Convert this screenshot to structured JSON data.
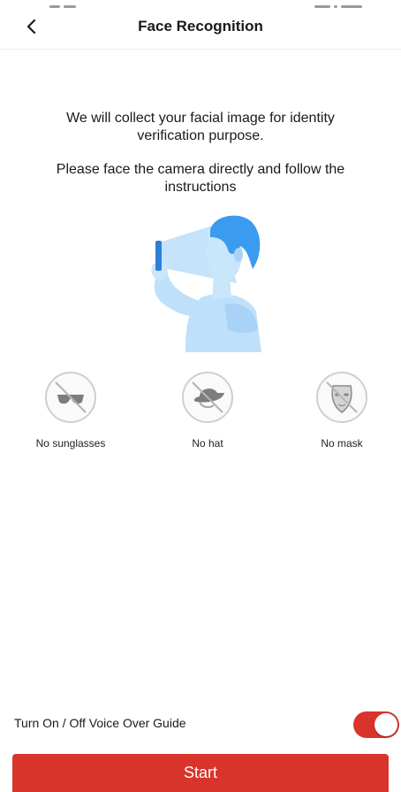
{
  "header": {
    "title": "Face Recognition"
  },
  "instructions": {
    "line1": "We will collect your facial image for identity verification purpose.",
    "line2": "Please face the camera directly and follow the instructions"
  },
  "requirements": [
    {
      "label": "No sunglasses",
      "icon": "no-sunglasses-icon"
    },
    {
      "label": "No hat",
      "icon": "no-hat-icon"
    },
    {
      "label": "No mask",
      "icon": "no-mask-icon"
    }
  ],
  "voice_guide": {
    "label": "Turn On / Off Voice Over Guide",
    "enabled": true
  },
  "start_button": {
    "label": "Start"
  },
  "colors": {
    "accent": "#d9342b",
    "illustration_blue": "#3a9bf0",
    "illustration_light": "#bfe0fa"
  }
}
